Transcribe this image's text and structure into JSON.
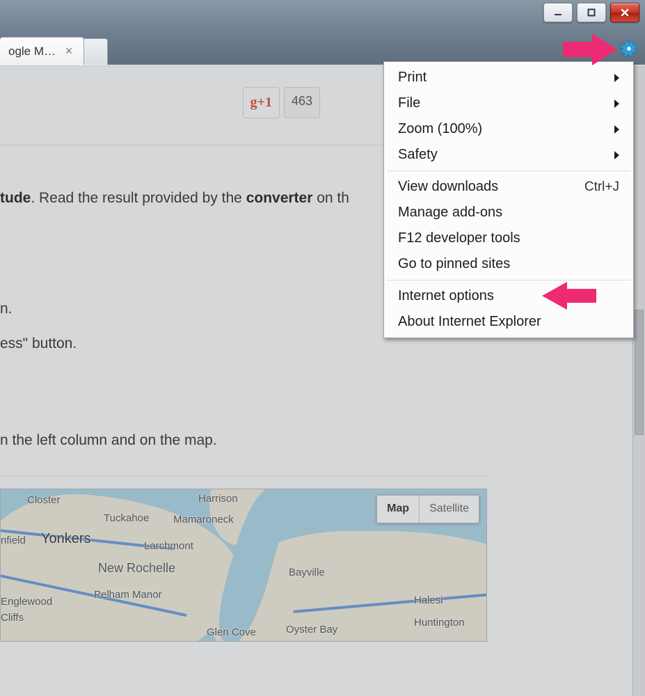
{
  "tab": {
    "title": "ogle M…"
  },
  "gplus": {
    "label": "g+1",
    "count": "463"
  },
  "text": {
    "line1_pre": "tude",
    "line1_mid": ". Read the result provided by the ",
    "line1_bold": "converter",
    "line1_post": " on th",
    "line2a": "n.",
    "line2b": "ess\" button.",
    "line3": "n the left column and on the map."
  },
  "map": {
    "btn_map": "Map",
    "btn_sat": "Satellite",
    "labels": {
      "closter": "Closter",
      "harrison": "Harrison",
      "tuckahoe": "Tuckahoe",
      "mamaroneck": "Mamaroneck",
      "yonkers": "Yonkers",
      "nfield": "nfield",
      "larchmont": "Larchmont",
      "newrochelle": "New Rochelle",
      "bayville": "Bayville",
      "pelham": "Pelham Manor",
      "englewood": "Englewood\nCliffs",
      "halesi": "Halesi",
      "oyster": "Oyster Bay",
      "glencove": "Glen Cove",
      "huntington": "Huntington"
    }
  },
  "menu": {
    "print": "Print",
    "file": "File",
    "zoom": "Zoom (100%)",
    "safety": "Safety",
    "downloads": "View downloads",
    "downloads_short": "Ctrl+J",
    "addons": "Manage add-ons",
    "devtools": "F12 developer tools",
    "pinned": "Go to pinned sites",
    "options": "Internet options",
    "about": "About Internet Explorer"
  }
}
